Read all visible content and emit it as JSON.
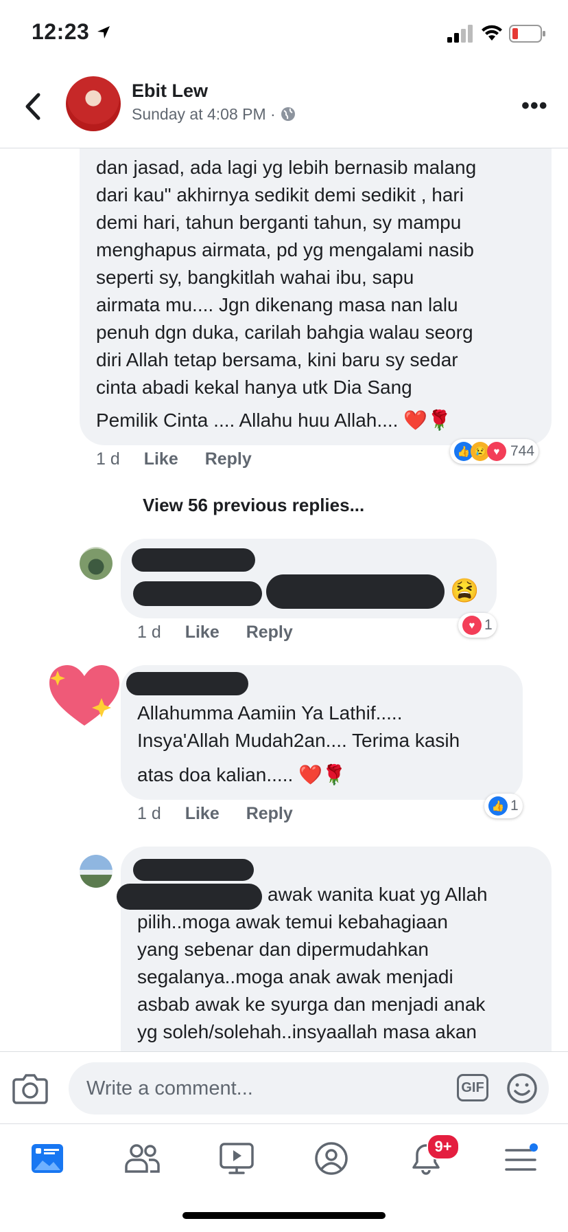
{
  "status_bar": {
    "time": "12:23"
  },
  "header": {
    "poster_name": "Ebit Lew",
    "post_time": "Sunday at 4:08 PM ·"
  },
  "comments": [
    {
      "text": "dan jasad, ada lagi yg lebih bernasib malang\ndari kau\" akhirnya sedikit demi sedikit , hari\ndemi hari, tahun berganti tahun, sy mampu\nmenghapus airmata, pd yg mengalami nasib\nseperti sy, bangkitlah wahai ibu, sapu\nairmata mu.... Jgn dikenang masa nan lalu\npenuh dgn duka, carilah bahgia walau seorg\ndiri Allah tetap bersama, kini baru sy sedar\ncinta abadi  kekal hanya utk Dia Sang",
      "last_line": "Pemilik Cinta .... Allahu huu Allah.... ❤️🌹",
      "time": "1 d",
      "like_label": "Like",
      "reply_label": "Reply",
      "reaction_count": "744"
    },
    {
      "time": "1 d",
      "like_label": "Like",
      "reply_label": "Reply",
      "reaction_count": "1",
      "emoji": "😫"
    },
    {
      "text": "Allahumma Aamiin Ya Lathif.....\nInsya'Allah Mudah2an.... Terima kasih",
      "last_line": "atas doa kalian..... ❤️🌹",
      "time": "1 d",
      "like_label": "Like",
      "reply_label": "Reply",
      "reaction_count": "1"
    },
    {
      "first_line": "awak wanita kuat yg Allah",
      "text": "pilih..moga awak temui kebahagiaan\nyang sebenar dan dipermudahkan\nsegalanya..moga anak awak menjadi\nasbab awak ke syurga dan menjadi anak\nyg soleh/solehah..insyaallah masa akan"
    }
  ],
  "view_previous": "View 56 previous replies...",
  "composer": {
    "placeholder": "Write a comment...",
    "gif_label": "GIF"
  },
  "tab_bar": {
    "notification_badge": "9+"
  },
  "colors": {
    "accent": "#1877f2",
    "bubble": "#f0f2f5",
    "meta": "#606770",
    "badge": "#e41e3f"
  }
}
